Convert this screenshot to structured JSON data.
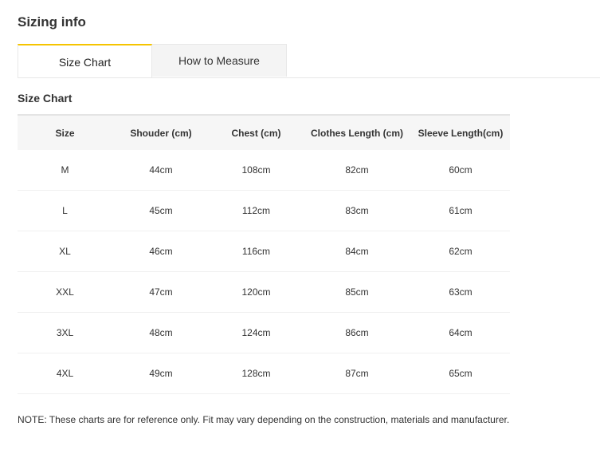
{
  "page": {
    "title": "Sizing info"
  },
  "tabs": [
    {
      "label": "Size Chart",
      "active": true
    },
    {
      "label": "How to Measure",
      "active": false
    }
  ],
  "colors": {
    "active_tab_accent": "#f5c400",
    "header_background": "#f6f6f6",
    "inactive_tab_background": "#f4f4f4"
  },
  "size_chart": {
    "title": "Size Chart",
    "columns": [
      "Size",
      "Shouder (cm)",
      "Chest (cm)",
      "Clothes Length (cm)",
      "Sleeve Length(cm)"
    ],
    "rows": [
      [
        "M",
        "44cm",
        "108cm",
        "82cm",
        "60cm"
      ],
      [
        "L",
        "45cm",
        "112cm",
        "83cm",
        "61cm"
      ],
      [
        "XL",
        "46cm",
        "116cm",
        "84cm",
        "62cm"
      ],
      [
        "XXL",
        "47cm",
        "120cm",
        "85cm",
        "63cm"
      ],
      [
        "3XL",
        "48cm",
        "124cm",
        "86cm",
        "64cm"
      ],
      [
        "4XL",
        "49cm",
        "128cm",
        "87cm",
        "65cm"
      ]
    ]
  },
  "note": "NOTE: These charts are for reference only. Fit may vary depending on the construction, materials and manufacturer."
}
